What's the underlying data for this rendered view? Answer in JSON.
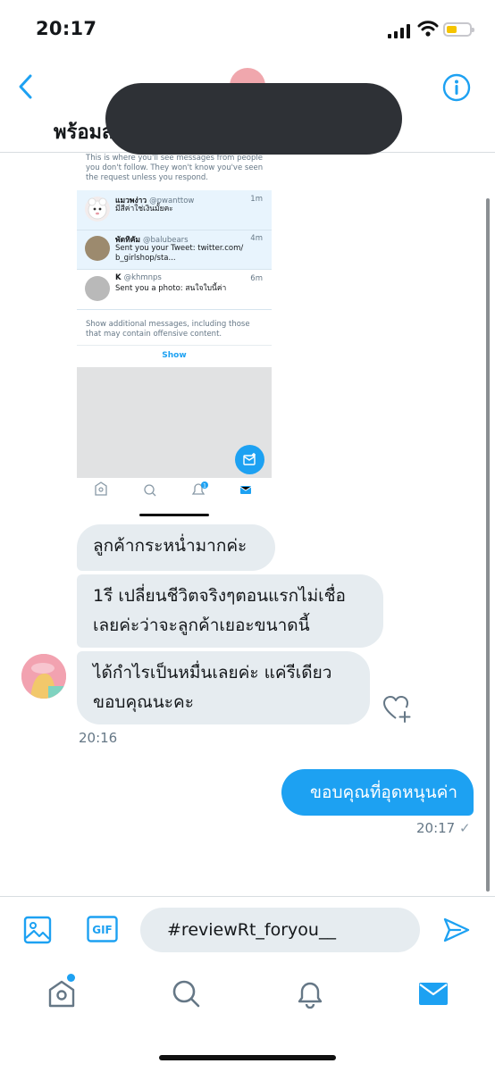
{
  "status_bar": {
    "time": "20:17"
  },
  "header": {
    "title": "พร้อมส…ๆ … … …ดค่อะ...",
    "back_icon": "chevron-left-icon",
    "info_icon": "info-icon"
  },
  "embed": {
    "intro": "This is where you'll see messages from people you don't follow. They won't know you've seen the request unless you respond.",
    "requests": [
      {
        "name": "แมวพง่าว",
        "handle": "@pwanttow",
        "time": "1m",
        "text": "มีสีค่าใช่เงินมั้ยคะ"
      },
      {
        "name": "พัดทิคัม",
        "handle": "@balubears",
        "time": "4m",
        "text": "Sent you your Tweet: twitter.com/ b_girlshop/sta..."
      },
      {
        "name": "K",
        "handle": "@khmnps",
        "time": "6m",
        "text": "Sent you a photo: สนใจใบนี้ค่า"
      }
    ],
    "more_text": "Show additional messages, including those that may contain offensive content.",
    "show_label": "Show",
    "notification_badge": "1"
  },
  "messages": {
    "incoming": [
      "ลูกค้ากระหน่ำมากค่ะ",
      "1รี เปลี่ยนชีวิตจริงๆตอนแรกไม่เชื่อ เลยค่ะว่าจะลูกค้าเยอะขนาดนี้",
      "ได้กำไรเป็นหมื่นเลยค่ะ แค่รีเดียว ขอบคุณนะคะ"
    ],
    "incoming_time": "20:16",
    "outgoing": "ขอบคุณที่อุดหนุนค่า",
    "outgoing_time": "20:17",
    "outgoing_status": "✓"
  },
  "composer": {
    "gif_label": "GIF",
    "input_value": "#reviewRt_foryou__"
  },
  "colors": {
    "accent": "#1da1f2",
    "bubble_incoming": "#e6ecf0",
    "text_secondary": "#657786"
  }
}
